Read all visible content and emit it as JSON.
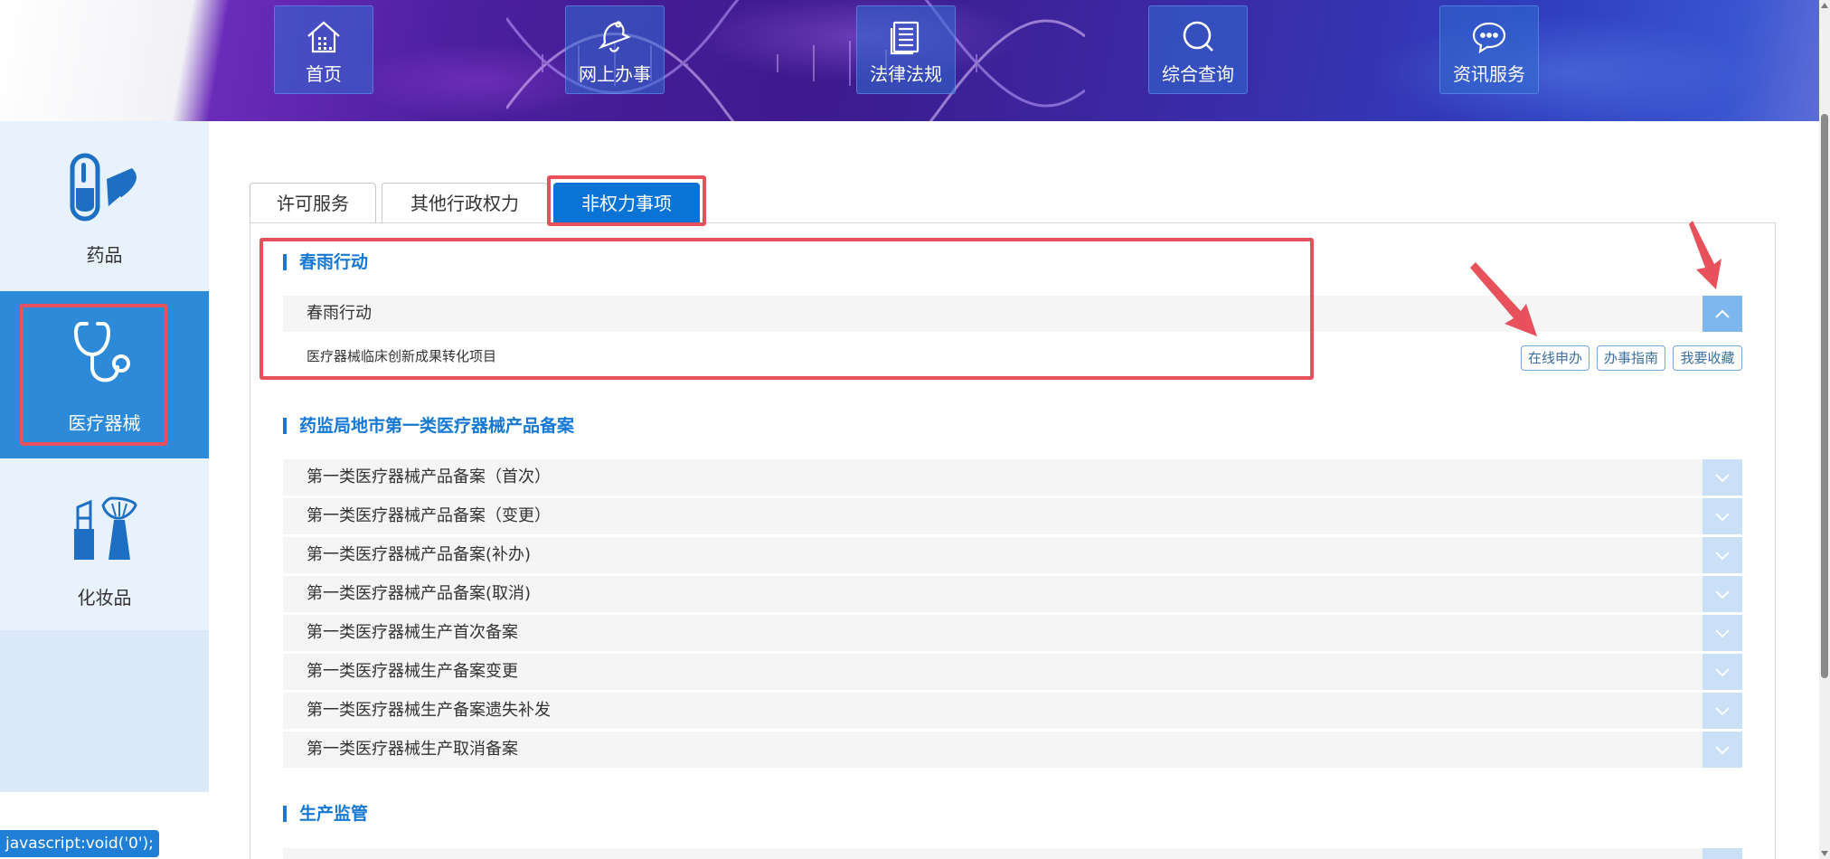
{
  "header": {
    "nav": [
      {
        "label": "首页",
        "icon": "home-icon"
      },
      {
        "label": "网上办事",
        "icon": "bell-icon"
      },
      {
        "label": "法律法规",
        "icon": "document-icon"
      },
      {
        "label": "综合查询",
        "icon": "search-icon"
      },
      {
        "label": "资讯服务",
        "icon": "chat-icon"
      }
    ]
  },
  "sidebar": {
    "items": [
      {
        "label": "药品",
        "icon": "pill-icon"
      },
      {
        "label": "医疗器械",
        "icon": "stethoscope-icon",
        "active": true
      },
      {
        "label": "化妆品",
        "icon": "cosmetics-icon"
      }
    ]
  },
  "tabs": [
    {
      "label": "许可服务"
    },
    {
      "label": "其他行政权力"
    },
    {
      "label": "非权力事项",
      "active": true
    }
  ],
  "sections": [
    {
      "title": "春雨行动",
      "rows": [
        {
          "label": "春雨行动",
          "expanded": true,
          "sub_items": [
            {
              "label": "医疗器械临床创新成果转化项目",
              "actions": [
                "在线申办",
                "办事指南",
                "我要收藏"
              ]
            }
          ]
        }
      ]
    },
    {
      "title": "药监局地市第一类医疗器械产品备案",
      "rows": [
        {
          "label": "第一类医疗器械产品备案（首次）"
        },
        {
          "label": "第一类医疗器械产品备案（变更）"
        },
        {
          "label": "第一类医疗器械产品备案(补办)"
        },
        {
          "label": "第一类医疗器械产品备案(取消)"
        },
        {
          "label": "第一类医疗器械生产首次备案"
        },
        {
          "label": "第一类医疗器械生产备案变更"
        },
        {
          "label": "第一类医疗器械生产备案遗失补发"
        },
        {
          "label": "第一类医疗器械生产取消备案"
        }
      ]
    },
    {
      "title": "生产监管",
      "rows": []
    }
  ],
  "status_bar": {
    "text": "javascript:void('0');"
  },
  "colors": {
    "accent": "#0a74d6",
    "section_title": "#1778d3",
    "sidebar_active": "#2d8ad9",
    "highlight": "#e8505b"
  }
}
